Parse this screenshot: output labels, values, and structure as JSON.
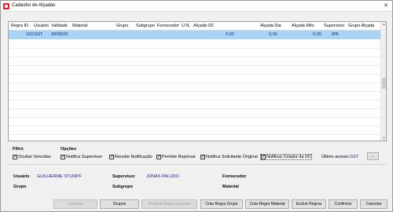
{
  "window": {
    "title": "Cadastro de Alçadas",
    "close_glyph": "✕"
  },
  "grid": {
    "columns": [
      "Regra ID",
      "Usuário",
      "Validade",
      "Material",
      "Grupo",
      "Subgrupo",
      "Fornecedor",
      "U.N.",
      "Alçada OC",
      "Alçada Dia",
      "Alçada Mês",
      "Supervisor",
      "Grupo Alçada"
    ],
    "selected_row": {
      "regra_id": "162",
      "usuario": "GST",
      "validade": "30/06/20",
      "alcada_oc": "0,00",
      "alcada_dia": "0,00",
      "alcada_mes": "0,00",
      "supervisor": "JPA"
    }
  },
  "filtro": {
    "label": "Filtro",
    "ocultar_vencidas": "Ocultar Vencidas"
  },
  "opcoes": {
    "label": "Opções",
    "items": [
      "Notifica Supervisor",
      "Recebe Notificação",
      "Permite Reprovar",
      "Notifica Solicitante Original",
      "Notificar Criador da OC"
    ]
  },
  "ultimo_acesso": {
    "label": "Último acesso",
    "value": "GST",
    "button": "..."
  },
  "info": {
    "usuario_label": "Usuário",
    "usuario_value": "GUILHERME STUMPF",
    "supervisor_label": "Supervisor",
    "supervisor_value": "JONAS PALUDO",
    "fornecedor_label": "Fornecedor",
    "grupo_label": "Grupo",
    "subgrupo_label": "Subgrupo",
    "material_label": "Material"
  },
  "buttons": {
    "usuarios": "Usuários",
    "grupos": "Grupos",
    "replicar": "Replicar Regra Usuários",
    "criar_grupo": "Criar Regra Grupo",
    "criar_material": "Criar Regra Material",
    "excluir": "Excluir Regras",
    "confirmar": "Confirmar",
    "cancelar": "Cancelar"
  }
}
